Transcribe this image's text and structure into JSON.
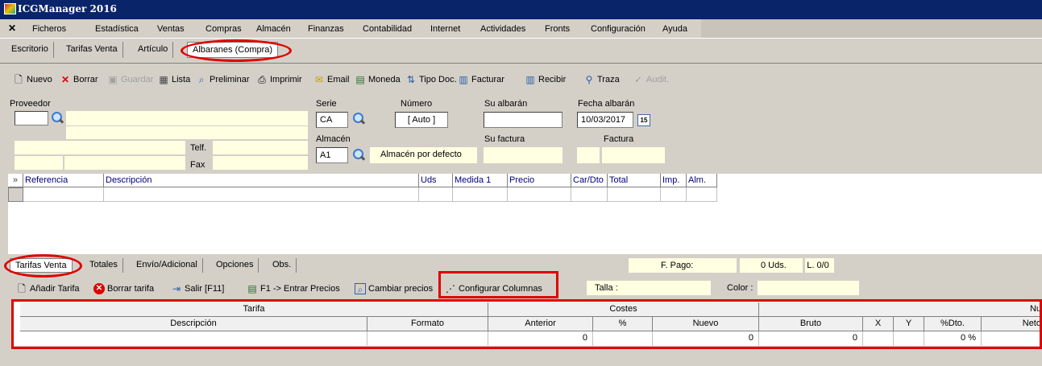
{
  "app": {
    "title": "ICGManager 2016"
  },
  "menu": [
    "Ficheros",
    "Estadística",
    "Ventas",
    "Compras",
    "Almacén",
    "Finanzas",
    "Contabilidad",
    "Internet",
    "Actividades",
    "Fronts",
    "Configuración",
    "Ayuda"
  ],
  "doc_tabs": [
    "Escritorio",
    "Tarifas Venta",
    "Artículo",
    "Albaranes (Compra)"
  ],
  "toolbar": {
    "nuevo": "Nuevo",
    "borrar": "Borrar",
    "guardar": "Guardar",
    "lista": "Lista",
    "preliminar": "Preliminar",
    "imprimir": "Imprimir",
    "email": "Email",
    "moneda": "Moneda",
    "tipo_doc": "Tipo Doc.",
    "facturar": "Facturar",
    "recibir": "Recibir",
    "traza": "Traza",
    "audit": "Audit."
  },
  "header": {
    "proveedor_label": "Proveedor",
    "telf_label": "Telf.",
    "fax_label": "Fax",
    "serie_label": "Serie",
    "serie_value": "CA",
    "numero_label": "Número",
    "numero_value": "[ Auto ]",
    "su_albaran_label": "Su albarán",
    "fecha_label": "Fecha albarán",
    "fecha_value": "10/03/2017",
    "calendar_day": "15",
    "almacen_label": "Almacén",
    "almacen_value": "A1",
    "almacen_desc": "Almacén por defecto",
    "su_factura_label": "Su factura",
    "factura_label": "Factura"
  },
  "lines_grid": {
    "marker": "»",
    "columns": [
      "Referencia",
      "Descripción",
      "Uds",
      "Medida 1",
      "Precio",
      "Car/Dto",
      "Total",
      "Imp.",
      "Alm."
    ]
  },
  "lower_tabs": [
    "Tarifas Venta",
    "Totales",
    "Envío/Adicional",
    "Opciones",
    "Obs."
  ],
  "status": {
    "f_pago": "F. Pago:",
    "uds": "0 Uds.",
    "lineas": "L. 0/0"
  },
  "lower_toolbar": {
    "anadir": "Añadir Tarifa",
    "borrar": "Borrar tarifa",
    "salir": "Salir [F11]",
    "entrar": "F1 -> Entrar Precios",
    "cambiar": "Cambiar precios",
    "configurar": "Configurar Columnas",
    "talla": "Talla :",
    "color": "Color :"
  },
  "tarifa_grid": {
    "group_headers": [
      "Tarifa",
      "Costes",
      "Nu"
    ],
    "columns": [
      "Descripción",
      "Formato",
      "Anterior",
      "%",
      "Nuevo",
      "Bruto",
      "X",
      "Y",
      "%Dto.",
      "Neto"
    ],
    "row": {
      "anterior": "0",
      "nuevo": "0",
      "bruto": "0",
      "dto": "0 %"
    }
  },
  "colors": {
    "titlebar": "#0a246a",
    "annotation": "#e00000",
    "field_yellow": "#ffffe1"
  }
}
